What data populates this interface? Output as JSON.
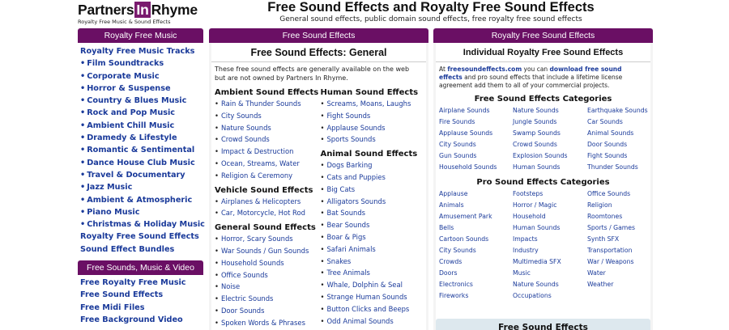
{
  "logo": {
    "part1": "Partners",
    "part2": "In",
    "part3": "Rhyme",
    "tagline": "Royalty Free Music & Sound Effects"
  },
  "header": {
    "title": "Free Sound Effects and Royalty Free Sound Effects",
    "subtitle": "General sound effects, public domain sound effects, free royalty free sound effects"
  },
  "left": {
    "bar1": "Royalty Free Music",
    "items": [
      {
        "label": "Royalty Free Music Tracks",
        "bullet": false
      },
      {
        "label": "Film Soundtracks",
        "bullet": true
      },
      {
        "label": "Corporate Music",
        "bullet": true
      },
      {
        "label": "Horror & Suspense",
        "bullet": true
      },
      {
        "label": "Country & Blues Music",
        "bullet": true
      },
      {
        "label": "Rock and Pop Music",
        "bullet": true
      },
      {
        "label": "Ambient Chill Music",
        "bullet": true
      },
      {
        "label": "Dramedy & Lifestyle",
        "bullet": true
      },
      {
        "label": "Romantic & Sentimental",
        "bullet": true
      },
      {
        "label": "Dance House Club Music",
        "bullet": true
      },
      {
        "label": "Travel & Documentary",
        "bullet": true
      },
      {
        "label": "Jazz Music",
        "bullet": true
      },
      {
        "label": "Ambient & Atmospheric",
        "bullet": true
      },
      {
        "label": "Piano Music",
        "bullet": true
      },
      {
        "label": "Christmas & Holiday Music",
        "bullet": true
      },
      {
        "label": "Royalty Free Sound Effects",
        "bullet": false
      },
      {
        "label": "Sound Effect Bundles",
        "bullet": false
      }
    ],
    "bar2": "Free Sounds, Music & Video",
    "items2": [
      "Free Royalty Free Music",
      "Free Sound Effects",
      "Free Midi Files",
      "Free Background Video"
    ]
  },
  "middle": {
    "bar": "Free Sound Effects",
    "title": "Free Sound Effects: General",
    "intro": "These free sound effects are generally available on the web but are not owned by Partners In Rhyme.",
    "col1": [
      {
        "heading": "Ambient Sound Effects",
        "items": [
          "Rain & Thunder Sounds",
          "City Sounds",
          "Nature Sounds",
          "Crowd Sounds",
          "Impact & Destruction",
          "Ocean, Streams, Water",
          "Religion & Ceremony"
        ]
      },
      {
        "heading": "Vehicle Sound Effects",
        "items": [
          "Airplanes & Helicopters",
          "Car, Motorcycle, Hot Rod"
        ]
      },
      {
        "heading": "General Sound Effects",
        "items": [
          "Horror, Scary Sounds",
          "War Sounds / Gun Sounds",
          "Household Sounds",
          "Office Sounds",
          "Noise",
          "Electric Sounds",
          "Door Sounds",
          "Spoken Words & Phrases"
        ]
      }
    ],
    "col2": [
      {
        "heading": "Human Sound Effects",
        "items": [
          "Screams, Moans, Laughs",
          "Fight Sounds",
          "Applause Sounds",
          "Sports Sounds"
        ]
      },
      {
        "heading": "Animal Sound Effects",
        "items": [
          "Dogs Barking",
          "Cats and Puppies",
          "Big Cats",
          "Alligators Sounds",
          "Bat Sounds",
          "Bear Sounds",
          "Boar & Pigs",
          "Safari Animals",
          "Snakes",
          "Tree Animals",
          "Whale, Dolphin & Seal",
          "Strange Human Sounds",
          "Button Clicks and Beeps",
          "Odd Animal Sounds"
        ]
      }
    ]
  },
  "right": {
    "bar": "Royalty Free Sound Effects",
    "title": "Individual Royalty Free Sound Effects",
    "intro_pre": "At ",
    "intro_site": "freesoundeffects.com",
    "intro_mid": " you can ",
    "intro_link": "download free sound effects",
    "intro_post": " and pro sound effects that include a lifetime license agreement add them to all of your commercial projects.",
    "free_heading": "Free Sound Effects Categories",
    "free_items": [
      "Airplane Sounds",
      "Nature Sounds",
      "Earthquake Sounds",
      "Fire Sounds",
      "Jungle Sounds",
      "Car Sounds",
      "Applause Sounds",
      "Swamp Sounds",
      "Animal Sounds",
      "City Sounds",
      "Crowd Sounds",
      "Door Sounds",
      "Gun Sounds",
      "Explosion Sounds",
      "Fight Sounds",
      "Household Sounds",
      "Human Sounds",
      "Thunder Sounds"
    ],
    "pro_heading": "Pro Sound Effects Categories",
    "pro_items": [
      "Applause",
      "Footsteps",
      "Office Sounds",
      "Animals",
      "Horror / Magic",
      "Religion",
      "Amusement Park",
      "Household",
      "Roomtones",
      "Bells",
      "Human Sounds",
      "Sports / Games",
      "Cartoon Sounds",
      "Impacts",
      "Synth SFX",
      "City Sounds",
      "Industry",
      "Transportation",
      "Crowds",
      "Multimedia SFX",
      "War / Weapons",
      "Doors",
      "Music",
      "Water",
      "Electronics",
      "Nature Sounds",
      "Weather",
      "Fireworks",
      "Occupations",
      ""
    ],
    "bottom_bar": "Free Sound Effects"
  }
}
